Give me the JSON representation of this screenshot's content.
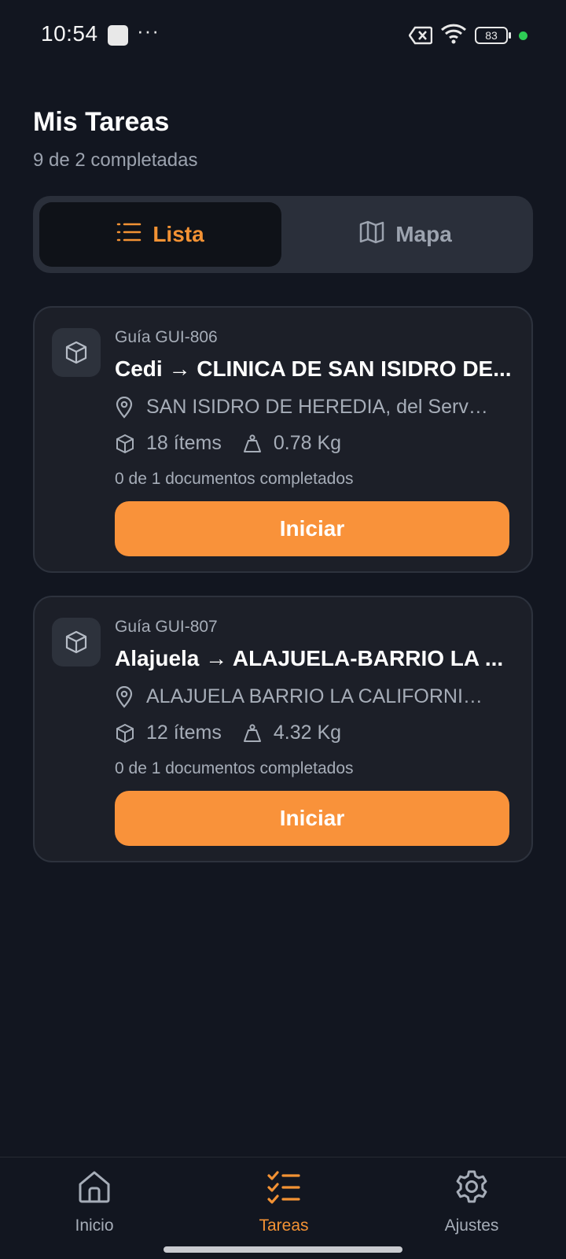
{
  "status_bar": {
    "time": "10:54",
    "battery": "83",
    "icons": [
      "app-notification-icon",
      "more-dots-icon",
      "no-sim-icon",
      "wifi-icon",
      "battery-icon",
      "active-dot-icon"
    ]
  },
  "header": {
    "title": "Mis Tareas",
    "subtitle": "9 de 2 completadas"
  },
  "view_toggle": {
    "selected": "lista",
    "lista_label": "Lista",
    "mapa_label": "Mapa",
    "lista_icon": "list-icon",
    "mapa_icon": "map-icon"
  },
  "tasks": [
    {
      "guide": "Guía GUI-806",
      "title": "Cedi → CLINICA DE SAN ISIDRO DE...",
      "address": "SAN ISIDRO DE HEREDIA, del Servic...",
      "items": "18 ítems",
      "weight": "0.78 Kg",
      "docs": "0 de 1 documentos completados",
      "button": "Iniciar"
    },
    {
      "guide": "Guía GUI-807",
      "title": "Alajuela → ALAJUELA-BARRIO LA ...",
      "address": "ALAJUELA BARRIO LA CALIFORNIA ...",
      "items": "12 ítems",
      "weight": "4.32 Kg",
      "docs": "0 de 1 documentos completados",
      "button": "Iniciar"
    }
  ],
  "bottom_nav": {
    "active": "tareas",
    "items": [
      {
        "label": "Inicio",
        "icon": "home-icon"
      },
      {
        "label": "Tareas",
        "icon": "task-list-icon"
      },
      {
        "label": "Ajustes",
        "icon": "gear-icon"
      }
    ]
  },
  "colors": {
    "accent": "#f9923a",
    "background": "#121620",
    "card": "#1c1f28",
    "muted_text": "#a6adb8",
    "status_dot": "#2ecc55"
  }
}
